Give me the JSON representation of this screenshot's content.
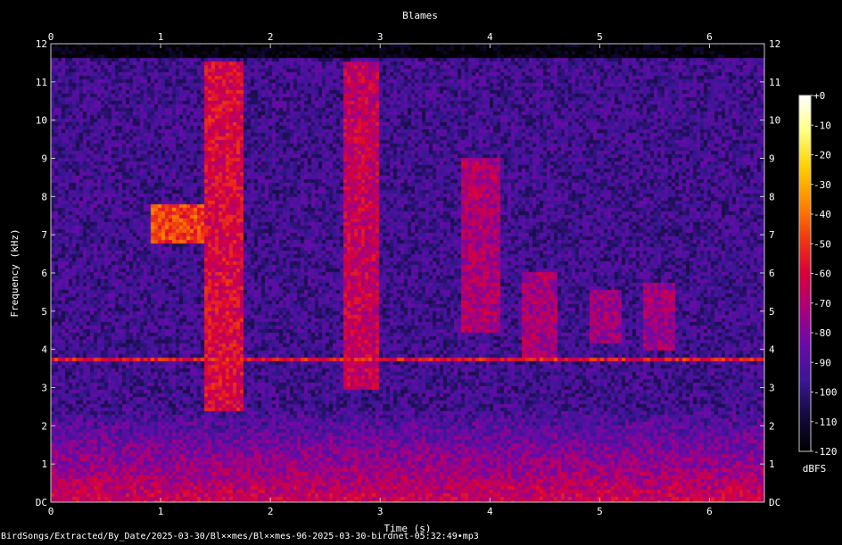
{
  "chart_data": {
    "type": "heatmap",
    "title": "Blames",
    "xlabel": "Time (s)",
    "ylabel": "Frequency (kHz)",
    "xlim": [
      0,
      6.5
    ],
    "ylim": [
      0,
      12
    ],
    "x_ticks": [
      {
        "value": 0,
        "label": "0"
      },
      {
        "value": 1,
        "label": "1"
      },
      {
        "value": 2,
        "label": "2"
      },
      {
        "value": 3,
        "label": "3"
      },
      {
        "value": 4,
        "label": "4"
      },
      {
        "value": 5,
        "label": "5"
      },
      {
        "value": 6,
        "label": "6"
      }
    ],
    "y_ticks": [
      {
        "value": 0,
        "label": "DC"
      },
      {
        "value": 1,
        "label": "1"
      },
      {
        "value": 2,
        "label": "2"
      },
      {
        "value": 3,
        "label": "3"
      },
      {
        "value": 4,
        "label": "4"
      },
      {
        "value": 5,
        "label": "5"
      },
      {
        "value": 6,
        "label": "6"
      },
      {
        "value": 7,
        "label": "7"
      },
      {
        "value": 8,
        "label": "8"
      },
      {
        "value": 9,
        "label": "9"
      },
      {
        "value": 10,
        "label": "10"
      },
      {
        "value": 11,
        "label": "11"
      },
      {
        "value": 12,
        "label": "12"
      }
    ],
    "colorbar": {
      "label": "dBFS",
      "range": [
        -120,
        0
      ],
      "ticks": [
        {
          "value": 0,
          "label": "+0"
        },
        {
          "value": -10,
          "label": "-10"
        },
        {
          "value": -20,
          "label": "-20"
        },
        {
          "value": -30,
          "label": "-30"
        },
        {
          "value": -40,
          "label": "-40"
        },
        {
          "value": -50,
          "label": "-50"
        },
        {
          "value": -60,
          "label": "-60"
        },
        {
          "value": -70,
          "label": "-70"
        },
        {
          "value": -80,
          "label": "-80"
        },
        {
          "value": -90,
          "label": "-90"
        },
        {
          "value": -100,
          "label": "-100"
        },
        {
          "value": -110,
          "label": "-110"
        },
        {
          "value": -120,
          "label": "-120"
        }
      ],
      "colors": [
        "#000000",
        "#140a3c",
        "#3a1696",
        "#6a0aa8",
        "#a8007c",
        "#d8003c",
        "#f03a10",
        "#ff8a00",
        "#ffd000",
        "#ffff80",
        "#ffffff"
      ]
    },
    "grid": false,
    "background_level_db": -95,
    "events": [
      {
        "name": "low-frequency noise floor",
        "t": [
          0,
          6.5
        ],
        "f": [
          0,
          2.5
        ],
        "level_db": -62
      },
      {
        "name": "steady tone",
        "t": [
          0,
          6.5
        ],
        "f": [
          3.75,
          3.85
        ],
        "level_db": -55
      },
      {
        "name": "harmonic call",
        "t": [
          0.9,
          1.4
        ],
        "f": [
          6.8,
          7.8
        ],
        "level_db": -48
      },
      {
        "name": "broadband burst",
        "t": [
          1.4,
          1.75
        ],
        "f": [
          2.4,
          11.5
        ],
        "level_db": -60
      },
      {
        "name": "broadband burst",
        "t": [
          2.65,
          3.0
        ],
        "f": [
          3.0,
          11.5
        ],
        "level_db": -65
      },
      {
        "name": "rising sweep",
        "t": [
          3.75,
          4.1
        ],
        "f": [
          4.5,
          9.0
        ],
        "level_db": -70
      },
      {
        "name": "chirp",
        "t": [
          4.3,
          4.6
        ],
        "f": [
          3.8,
          6.0
        ],
        "level_db": -72
      },
      {
        "name": "chirp",
        "t": [
          4.9,
          5.2
        ],
        "f": [
          4.2,
          5.6
        ],
        "level_db": -74
      },
      {
        "name": "chirp",
        "t": [
          5.4,
          5.7
        ],
        "f": [
          4.0,
          5.8
        ],
        "level_db": -74
      }
    ]
  },
  "footer": {
    "path": "BirdSongs/Extracted/By_Date/2025-03-30/Bl××mes/Bl××mes-96-2025-03-30-birdnet-05:32:49•mp3"
  }
}
